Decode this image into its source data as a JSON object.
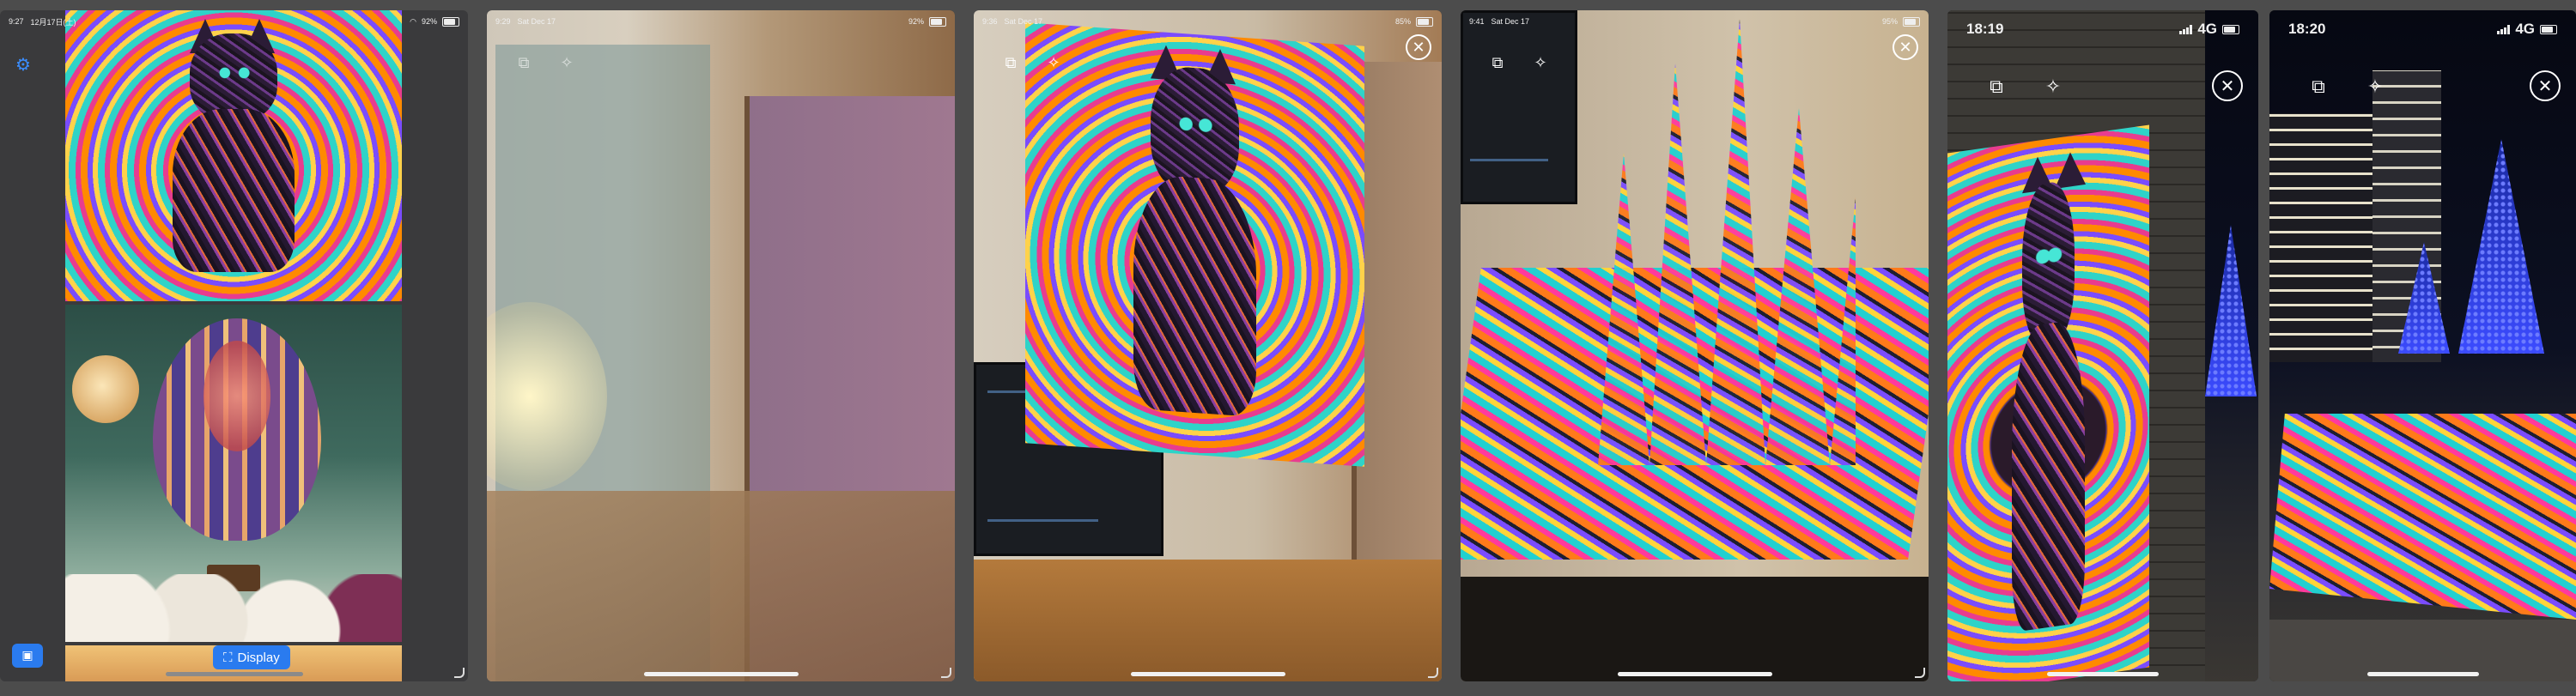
{
  "screens": [
    {
      "id": "gallery",
      "status": {
        "time": "9:27",
        "date": "12月17日(土)",
        "battery": "92%"
      },
      "display_button_label": "Display",
      "settings_icon": "gear-icon",
      "photo_icon": "photo-picker-icon"
    },
    {
      "id": "ar-room-start",
      "status": {
        "time": "9:29",
        "date": "Sat Dec 17",
        "battery": "92%"
      }
    },
    {
      "id": "ar-room-cat",
      "status": {
        "time": "9:36",
        "date": "Sat Dec 17",
        "battery": "85%"
      }
    },
    {
      "id": "ar-desk-3d",
      "status": {
        "time": "9:41",
        "date": "Sat Dec 17",
        "battery": "95%"
      }
    },
    {
      "id": "ar-night-wall",
      "status": {
        "time": "18:19",
        "network": "4G"
      }
    },
    {
      "id": "ar-night-floor",
      "status": {
        "time": "18:20",
        "network": "4G"
      }
    }
  ],
  "icons": {
    "close": "close-icon",
    "photo_add": "photo-add-icon",
    "magic": "magic-wand-icon"
  },
  "colors": {
    "accent": "#2a7bef",
    "background": "#4c4c4c"
  }
}
